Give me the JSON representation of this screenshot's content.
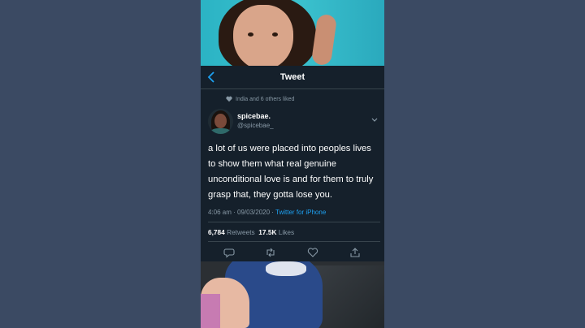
{
  "header": {
    "title": "Tweet",
    "back_icon": "chevron-left-icon"
  },
  "social_context": {
    "text": "India and 6 others liked",
    "icon": "heart-icon"
  },
  "author": {
    "display_name": "spicebae.",
    "handle": "@spicebae_"
  },
  "tweet": {
    "text": "a lot of us were placed into peoples lives to show them what real genuine unconditional love is and for them to truly grasp that, they gotta lose you.",
    "time": "4:06 am",
    "date": "09/03/2020",
    "source": "Twitter for iPhone"
  },
  "stats": {
    "retweets_count": "6,784",
    "retweets_label": "Retweets",
    "likes_count": "17.5K",
    "likes_label": "Likes"
  },
  "actions": [
    "reply-icon",
    "retweet-icon",
    "like-icon",
    "share-icon"
  ],
  "colors": {
    "background": "#15202b",
    "accent": "#1da1f2",
    "secondary_text": "#8899a6",
    "page_bg": "#3b4a63"
  }
}
